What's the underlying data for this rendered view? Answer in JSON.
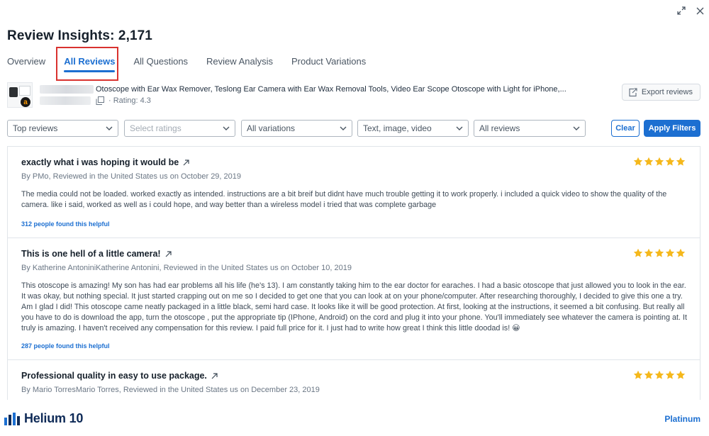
{
  "window": {
    "expand_icon": "expand-arrows-icon",
    "close_icon": "close-icon"
  },
  "header": {
    "title": "Review Insights: 2,171"
  },
  "tabs": [
    {
      "label": "Overview",
      "active": false
    },
    {
      "label": "All Reviews",
      "active": true
    },
    {
      "label": "All Questions",
      "active": false
    },
    {
      "label": "Review Analysis",
      "active": false
    },
    {
      "label": "Product Variations",
      "active": false
    }
  ],
  "product": {
    "title": "Otoscope with Ear Wax Remover, Teslong Ear Camera with Ear Wax Removal Tools, Video Ear Scope Otoscope with Light for iPhone,...",
    "rating": "· Rating: 4.3",
    "export_label": "Export reviews"
  },
  "filters": {
    "sort": "Top reviews",
    "ratings_placeholder": "Select ratings",
    "variations": "All variations",
    "media": "Text, image, video",
    "reviewers": "All reviews",
    "clear_label": "Clear",
    "apply_label": "Apply Filters"
  },
  "reviews": [
    {
      "title": "exactly what i was hoping it would be",
      "byline": "By PMo, Reviewed in the United States us on October 29, 2019",
      "body": "The media could not be loaded.  worked exactly as intended. instructions are a bit breif but didnt have much trouble getting it to work properly. i included a quick video to show the quality of the camera. like i said, worked as well as i could hope, and way better than a wireless model i tried that was complete garbage",
      "helpful": "312 people found this helpful",
      "stars": 5
    },
    {
      "title": "This is one hell of a little camera!",
      "byline": "By Katherine AntoniniKatherine Antonini, Reviewed in the United States us on October 10, 2019",
      "body": "This otoscope is amazing! My son has had ear problems all his life (he's 13). I am constantly taking him to the ear doctor for earaches. I had a basic otoscope that just allowed you to look in the ear. It was okay, but nothing special. It just started crapping out on me so I decided to get one that you can look at on your phone/computer. After researching thoroughly, I decided to give this one a try. Am I glad I did! This otoscope came neatly packaged in a little black, semi hard case. It looks like it will be good protection. At first, looking at the instructions, it seemed a bit confusing. But really all you have to do is download the app, turn the otoscope , put the appropriate tip (IPhone, Android) on the cord and plug it into your phone. You'll immediately see whatever the camera is pointing at. It truly is amazing. I haven't received any compensation for this review. I paid full price for it. I just had to write how great I think this little doodad is! 😀",
      "helpful": "287 people found this helpful",
      "stars": 5
    },
    {
      "title": "Professional quality in easy to use package.",
      "byline": "By Mario TorresMario Torres, Reviewed in the United States us on December 23, 2019",
      "stars": 5
    }
  ],
  "footer": {
    "brand": "Helium 10",
    "plan": "Platinum"
  },
  "colors": {
    "accent": "#1c6fd1",
    "star": "#f5b81c",
    "highlight_border": "#d9322f"
  }
}
